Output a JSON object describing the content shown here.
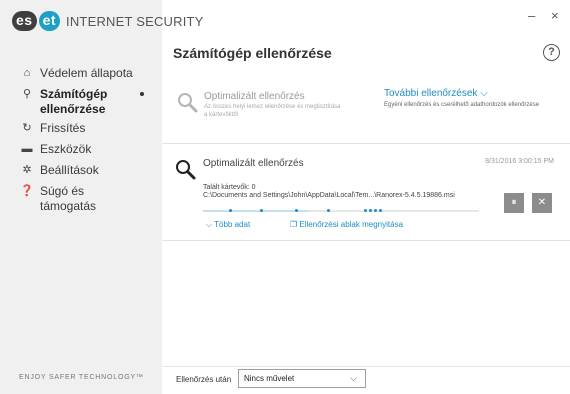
{
  "app": {
    "logo_left": "es",
    "logo_right": "et",
    "product_name": "INTERNET SECURITY",
    "tagline": "ENJOY SAFER TECHNOLOGY™"
  },
  "window": {
    "minimize_label": "–",
    "close_label": "×"
  },
  "sidebar": {
    "items": [
      {
        "label": "Védelem állapota",
        "icon": "home-icon",
        "glyph": "⌂"
      },
      {
        "label": "Számítógép ellenőrzése",
        "icon": "search-icon",
        "glyph": "⚲",
        "active": true
      },
      {
        "label": "Frissítés",
        "icon": "refresh-icon",
        "glyph": "↻"
      },
      {
        "label": "Eszközök",
        "icon": "briefcase-icon",
        "glyph": "▬"
      },
      {
        "label": "Beállítások",
        "icon": "gear-icon",
        "glyph": "✲"
      },
      {
        "label": "Súgó és támogatás",
        "icon": "help-icon",
        "glyph": "❓"
      }
    ]
  },
  "main": {
    "title": "Számítógép ellenőrzése",
    "help_label": "?",
    "optimized_scan": {
      "title": "Optimalizált ellenőrzés",
      "description": "Az összes helyi lemez ellenőrzése és megtisztítása a kártevőktől"
    },
    "more_scans": {
      "title": "További ellenőrzések ⌵",
      "description": "Egyéni ellenőrzés és cserélhető adathordozók ellenőrzése"
    },
    "active_scan": {
      "title": "Optimalizált ellenőrzés",
      "timestamp": "8/31/2016 3:00:15 PM",
      "found_label": "Talált kártevők: 0",
      "current_path": "C:\\Documents and Settings\\John\\AppData\\Local\\Tem...\\Ranorex-5.4.5.19886.msi",
      "progress": 0.38,
      "more_data_label": "⌵ Több adat",
      "open_log_label": "Ellenőrzési ablak megnyitása",
      "pause_label": "⏸",
      "stop_label": "✕"
    }
  },
  "footer": {
    "after_scan_label": "Ellenőrzés után",
    "after_scan_value": "Nincs művelet"
  },
  "colors": {
    "accent": "#1f8dc1",
    "logo_dark": "#3f3f3f",
    "logo_teal": "#1ea0c4",
    "sidebar_bg": "#f0f0f0",
    "button_gray": "#8c8c8c"
  }
}
